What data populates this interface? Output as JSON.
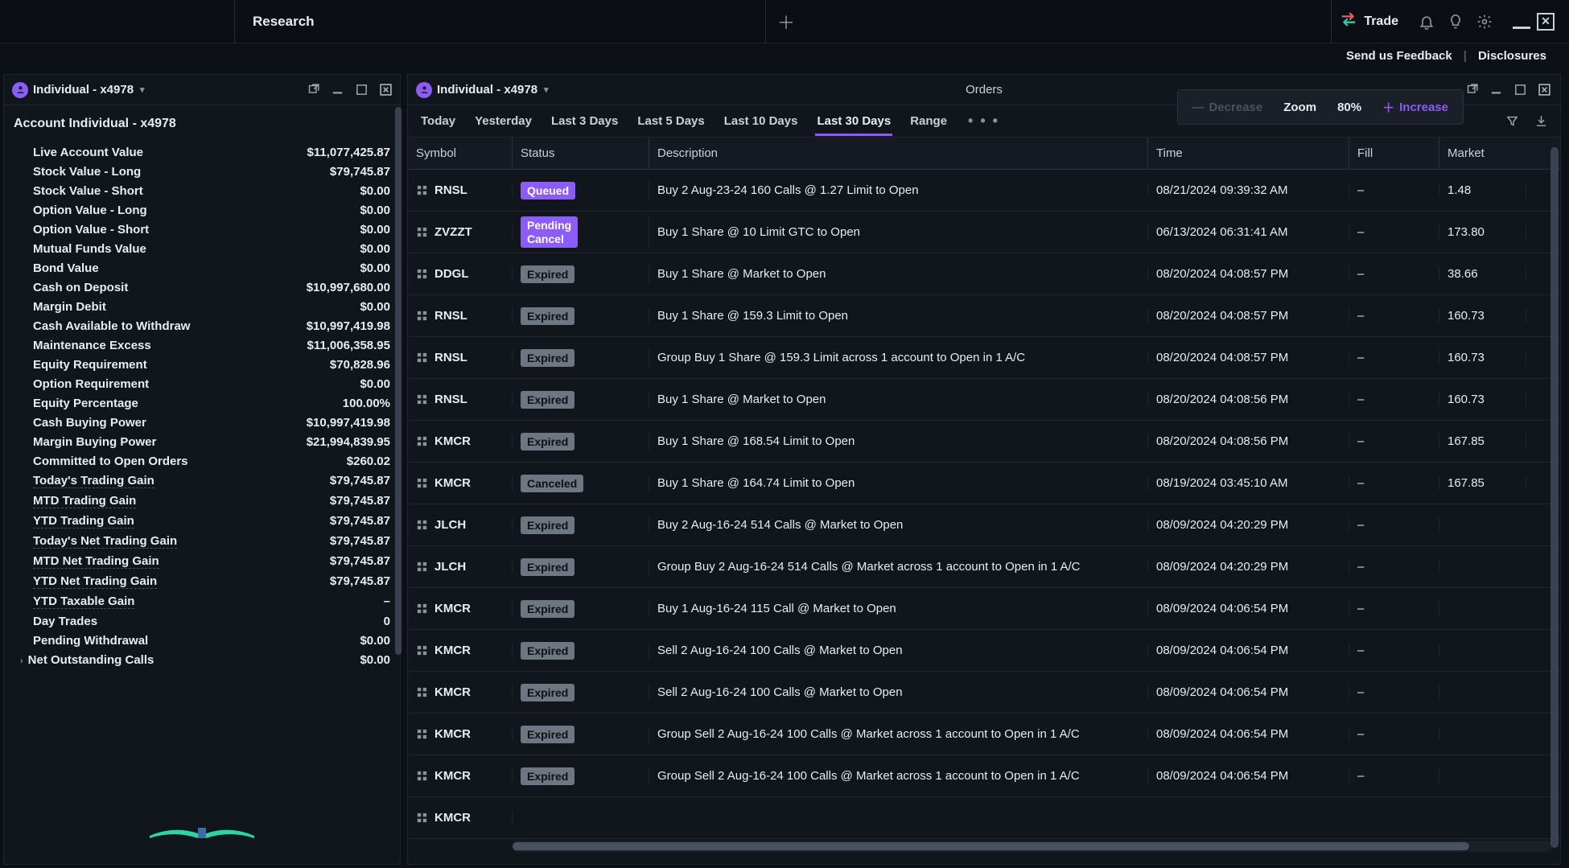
{
  "topbar": {
    "tab": "Research",
    "trade": "Trade",
    "feedback": "Send us Feedback",
    "disclosures": "Disclosures"
  },
  "zoom": {
    "decrease": "Decrease",
    "label": "Zoom",
    "value": "80%",
    "increase": "Increase"
  },
  "left": {
    "account_chip": "Individual - x4978",
    "title": "Account Individual - x4978",
    "stats": [
      {
        "label": "Live Account Value",
        "value": "$11,077,425.87",
        "dotted": false
      },
      {
        "label": "Stock Value - Long",
        "value": "$79,745.87",
        "dotted": false
      },
      {
        "label": "Stock Value - Short",
        "value": "$0.00",
        "dotted": false
      },
      {
        "label": "Option Value - Long",
        "value": "$0.00",
        "dotted": false
      },
      {
        "label": "Option Value - Short",
        "value": "$0.00",
        "dotted": false
      },
      {
        "label": "Mutual Funds Value",
        "value": "$0.00",
        "dotted": false
      },
      {
        "label": "Bond Value",
        "value": "$0.00",
        "dotted": false
      },
      {
        "label": "Cash on Deposit",
        "value": "$10,997,680.00",
        "dotted": false
      },
      {
        "label": "Margin Debit",
        "value": "$0.00",
        "dotted": false
      },
      {
        "label": "Cash Available to Withdraw",
        "value": "$10,997,419.98",
        "dotted": false
      },
      {
        "label": "Maintenance Excess",
        "value": "$11,006,358.95",
        "dotted": false
      },
      {
        "label": "Equity Requirement",
        "value": "$70,828.96",
        "dotted": false
      },
      {
        "label": "Option Requirement",
        "value": "$0.00",
        "dotted": false
      },
      {
        "label": "Equity Percentage",
        "value": "100.00%",
        "dotted": false
      },
      {
        "label": "Cash Buying Power",
        "value": "$10,997,419.98",
        "dotted": false
      },
      {
        "label": "Margin Buying Power",
        "value": "$21,994,839.95",
        "dotted": false
      },
      {
        "label": "Committed to Open Orders",
        "value": "$260.02",
        "dotted": false
      },
      {
        "label": "Today's Trading Gain",
        "value": "$79,745.87",
        "dotted": true
      },
      {
        "label": "MTD Trading Gain",
        "value": "$79,745.87",
        "dotted": true
      },
      {
        "label": "YTD Trading Gain",
        "value": "$79,745.87",
        "dotted": true
      },
      {
        "label": "Today's Net Trading Gain",
        "value": "$79,745.87",
        "dotted": true
      },
      {
        "label": "MTD Net Trading Gain",
        "value": "$79,745.87",
        "dotted": true
      },
      {
        "label": "YTD Net Trading Gain",
        "value": "$79,745.87",
        "dotted": true
      },
      {
        "label": "YTD Taxable Gain",
        "value": "–",
        "dotted": true
      },
      {
        "label": "Day Trades",
        "value": "0",
        "dotted": false
      },
      {
        "label": "Pending Withdrawal",
        "value": "$0.00",
        "dotted": false
      }
    ],
    "net_outstanding": {
      "label": "Net Outstanding Calls",
      "value": "$0.00"
    }
  },
  "right": {
    "account_chip": "Individual - x4978",
    "orders_label": "Orders",
    "date_tabs": [
      "Today",
      "Yesterday",
      "Last 3 Days",
      "Last 5 Days",
      "Last 10 Days",
      "Last 30 Days",
      "Range"
    ],
    "active_tab": "Last 30 Days",
    "columns": {
      "symbol": "Symbol",
      "status": "Status",
      "desc": "Description",
      "time": "Time",
      "fill": "Fill",
      "market": "Market"
    },
    "rows": [
      {
        "symbol": "RNSL",
        "status": "Queued",
        "status_cls": "Queued",
        "desc": "Buy 2 Aug-23-24 160 Calls @ 1.27 Limit to Open",
        "time": "08/21/2024 09:39:32 AM",
        "fill": "–",
        "market": "1.48"
      },
      {
        "symbol": "ZVZZT",
        "status": "Pending\nCancel",
        "status_cls": "PendingCancel",
        "desc": "Buy 1 Share @ 10 Limit GTC to Open",
        "time": "06/13/2024 06:31:41 AM",
        "fill": "–",
        "market": "173.80"
      },
      {
        "symbol": "DDGL",
        "status": "Expired",
        "status_cls": "Expired",
        "desc": "Buy 1 Share @ Market to Open",
        "time": "08/20/2024 04:08:57 PM",
        "fill": "–",
        "market": "38.66"
      },
      {
        "symbol": "RNSL",
        "status": "Expired",
        "status_cls": "Expired",
        "desc": "Buy 1 Share @ 159.3 Limit to Open",
        "time": "08/20/2024 04:08:57 PM",
        "fill": "–",
        "market": "160.73"
      },
      {
        "symbol": "RNSL",
        "status": "Expired",
        "status_cls": "Expired",
        "desc": "Group Buy 1 Share @ 159.3 Limit across 1 account to Open in 1 A/C",
        "time": "08/20/2024 04:08:57 PM",
        "fill": "–",
        "market": "160.73"
      },
      {
        "symbol": "RNSL",
        "status": "Expired",
        "status_cls": "Expired",
        "desc": "Buy 1 Share @ Market to Open",
        "time": "08/20/2024 04:08:56 PM",
        "fill": "–",
        "market": "160.73"
      },
      {
        "symbol": "KMCR",
        "status": "Expired",
        "status_cls": "Expired",
        "desc": "Buy 1 Share @ 168.54 Limit to Open",
        "time": "08/20/2024 04:08:56 PM",
        "fill": "–",
        "market": "167.85"
      },
      {
        "symbol": "KMCR",
        "status": "Canceled",
        "status_cls": "Canceled",
        "desc": "Buy 1 Share @ 164.74 Limit to Open",
        "time": "08/19/2024 03:45:10 AM",
        "fill": "–",
        "market": "167.85"
      },
      {
        "symbol": "JLCH",
        "status": "Expired",
        "status_cls": "Expired",
        "desc": "Buy 2 Aug-16-24 514 Calls @ Market to Open",
        "time": "08/09/2024 04:20:29 PM",
        "fill": "–",
        "market": ""
      },
      {
        "symbol": "JLCH",
        "status": "Expired",
        "status_cls": "Expired",
        "desc": "Group Buy 2 Aug-16-24 514 Calls @ Market across 1 account to Open in 1 A/C",
        "time": "08/09/2024 04:20:29 PM",
        "fill": "–",
        "market": ""
      },
      {
        "symbol": "KMCR",
        "status": "Expired",
        "status_cls": "Expired",
        "desc": "Buy 1 Aug-16-24 115 Call @ Market to Open",
        "time": "08/09/2024 04:06:54 PM",
        "fill": "–",
        "market": ""
      },
      {
        "symbol": "KMCR",
        "status": "Expired",
        "status_cls": "Expired",
        "desc": "Sell 2 Aug-16-24 100 Calls @ Market to Open",
        "time": "08/09/2024 04:06:54 PM",
        "fill": "–",
        "market": ""
      },
      {
        "symbol": "KMCR",
        "status": "Expired",
        "status_cls": "Expired",
        "desc": "Sell 2 Aug-16-24 100 Calls @ Market to Open",
        "time": "08/09/2024 04:06:54 PM",
        "fill": "–",
        "market": ""
      },
      {
        "symbol": "KMCR",
        "status": "Expired",
        "status_cls": "Expired",
        "desc": "Group Sell 2 Aug-16-24 100 Calls @ Market across 1 account to Open in 1 A/C",
        "time": "08/09/2024 04:06:54 PM",
        "fill": "–",
        "market": ""
      },
      {
        "symbol": "KMCR",
        "status": "Expired",
        "status_cls": "Expired",
        "desc": "Group Sell 2 Aug-16-24 100 Calls @ Market across 1 account to Open in 1 A/C",
        "time": "08/09/2024 04:06:54 PM",
        "fill": "–",
        "market": ""
      },
      {
        "symbol": "KMCR",
        "status": "",
        "status_cls": "",
        "desc": "",
        "time": "",
        "fill": "",
        "market": ""
      }
    ]
  }
}
